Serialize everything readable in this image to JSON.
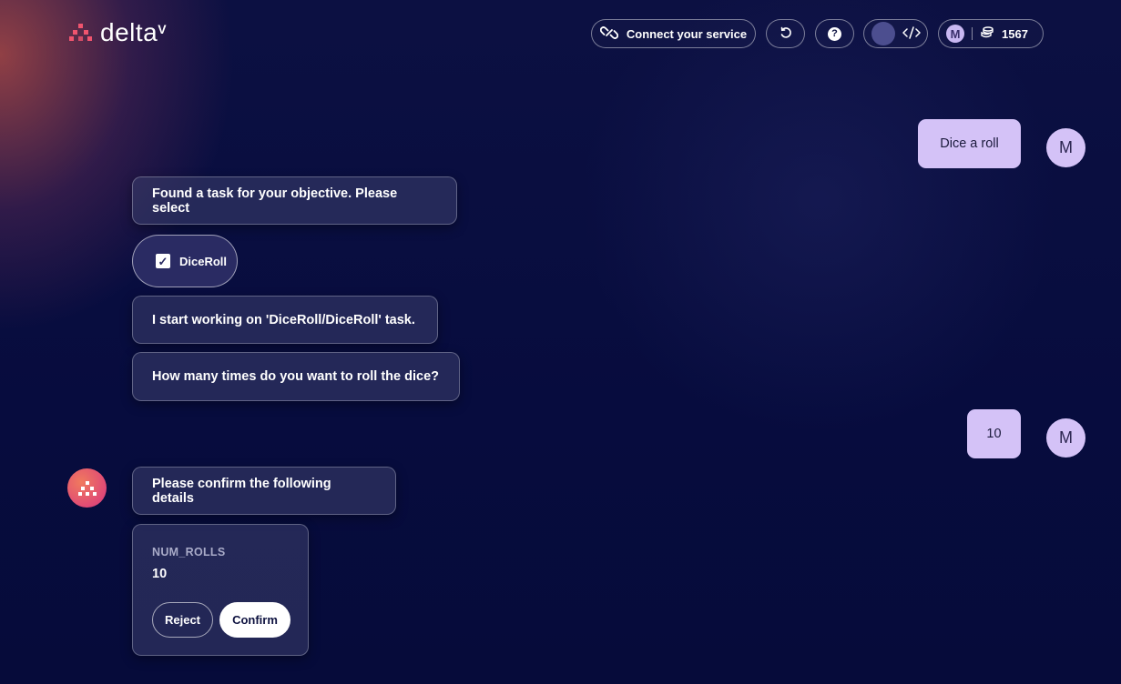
{
  "header": {
    "logo_text": "delta",
    "logo_superscript": "V",
    "connect_label": "Connect your service",
    "avatar_initial": "M",
    "credits": "1567"
  },
  "messages": {
    "user_1": "Dice a roll",
    "user_1_avatar": "M",
    "bot_found": "Found a task for your objective. Please select",
    "task_option": "DiceRoll",
    "bot_start": "I start working on 'DiceRoll/DiceRoll' task.",
    "bot_question": "How many times do you want to roll the dice?",
    "user_2": "10",
    "user_2_avatar": "M",
    "bot_confirm": "Please confirm the following details"
  },
  "confirm_card": {
    "field_label": "NUM_ROLLS",
    "field_value": "10",
    "reject_label": "Reject",
    "confirm_label": "Confirm"
  },
  "colors": {
    "accent": "#f0546e",
    "user_bubble": "#d4c2f7",
    "background": "#070c3e"
  },
  "icons": [
    "link-icon",
    "refresh-icon",
    "help-icon",
    "code-icon",
    "coins-icon",
    "checkbox-checked-icon",
    "bot-logo-icon"
  ]
}
